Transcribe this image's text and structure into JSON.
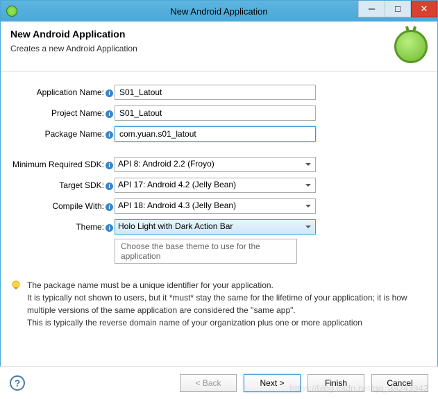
{
  "window": {
    "title": "New Android Application"
  },
  "header": {
    "title": "New Android Application",
    "subtitle": "Creates a new Android Application"
  },
  "form": {
    "app_name_label": "Application Name:",
    "app_name_value": "S01_Latout",
    "project_name_label": "Project Name:",
    "project_name_value": "S01_Latout",
    "package_name_label": "Package Name:",
    "package_name_value": "com.yuan.s01_latout",
    "min_sdk_label": "Minimum Required SDK:",
    "min_sdk_value": "API 8: Android 2.2 (Froyo)",
    "target_sdk_label": "Target SDK:",
    "target_sdk_value": "API 17: Android 4.2 (Jelly Bean)",
    "compile_label": "Compile With:",
    "compile_value": "API 18: Android 4.3 (Jelly Bean)",
    "theme_label": "Theme:",
    "theme_value": "Holo Light with Dark Action Bar",
    "theme_tooltip": "Choose the base theme to use for the application"
  },
  "hint": {
    "line1": "The package name must be a unique identifier for your application.",
    "line2": "It is typically not shown to users, but it *must* stay the same for the lifetime of your application; it is how multiple versions of the same application are considered the \"same app\".",
    "line3": "This is typically the reverse domain name of your organization plus one or more application"
  },
  "footer": {
    "back": "< Back",
    "next": "Next >",
    "finish": "Finish",
    "cancel": "Cancel"
  },
  "watermark": "https://blog.csdn.net/qq_38243942"
}
